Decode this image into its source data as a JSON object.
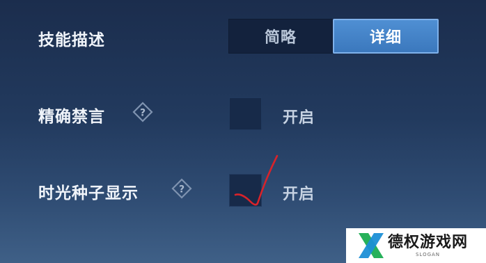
{
  "settings": {
    "skill_desc": {
      "label": "技能描述",
      "options": [
        "简略",
        "详细"
      ],
      "selected": "详细"
    },
    "precise_mute": {
      "label": "精确禁言",
      "checkbox_label": "开启",
      "checked": false,
      "help_icon": "question-diamond-icon"
    },
    "time_seed": {
      "label": "时光种子显示",
      "checkbox_label": "开启",
      "checked": false,
      "help_icon": "question-diamond-icon"
    }
  },
  "annotation": {
    "mark": "red-checkmark",
    "color": "#d8232a"
  },
  "watermark": {
    "title": "德权游戏网",
    "slogan": "SLOGAN",
    "logo_colors": [
      "#27b15a",
      "#1c8fd6"
    ]
  }
}
